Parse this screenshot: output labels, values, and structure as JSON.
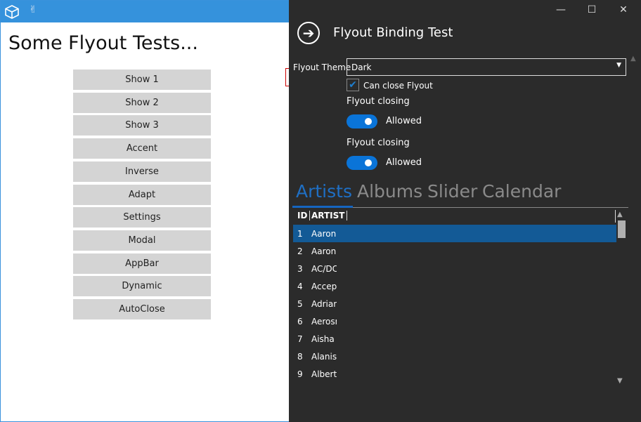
{
  "window": {
    "heading": "Some Flyout Tests...",
    "icons": [
      "cube-icon",
      "victory-hand-icon"
    ]
  },
  "buttons": [
    "Show 1",
    "Show 2",
    "Show 3",
    "Accent",
    "Inverse",
    "Adapt",
    "Settings",
    "Modal",
    "AppBar",
    "Dynamic",
    "AutoClose"
  ],
  "flyout": {
    "title": "Flyout Binding Test",
    "theme_label": "Flyout Theme",
    "theme_value": "Dark",
    "can_close_label": "Can close Flyout",
    "can_close_checked": true,
    "toggles": [
      {
        "header": "Flyout closing",
        "label": "Allowed",
        "on": true
      },
      {
        "header": "Flyout closing",
        "label": "Allowed",
        "on": true
      }
    ],
    "tabs": [
      "Artists",
      "Albums",
      "Slider",
      "Calendar"
    ],
    "selected_tab": "Artists",
    "grid": {
      "columns": [
        "ID",
        "ARTIST"
      ],
      "rows": [
        [
          "1",
          "Aaron"
        ],
        [
          "2",
          "Aaron"
        ],
        [
          "3",
          "AC/DC"
        ],
        [
          "4",
          "Accept"
        ],
        [
          "5",
          "Adrian"
        ],
        [
          "6",
          "Aerosm"
        ],
        [
          "7",
          "Aisha D"
        ],
        [
          "8",
          "Alanis"
        ],
        [
          "9",
          "Alberto"
        ]
      ]
    },
    "accent": "#135a96"
  }
}
